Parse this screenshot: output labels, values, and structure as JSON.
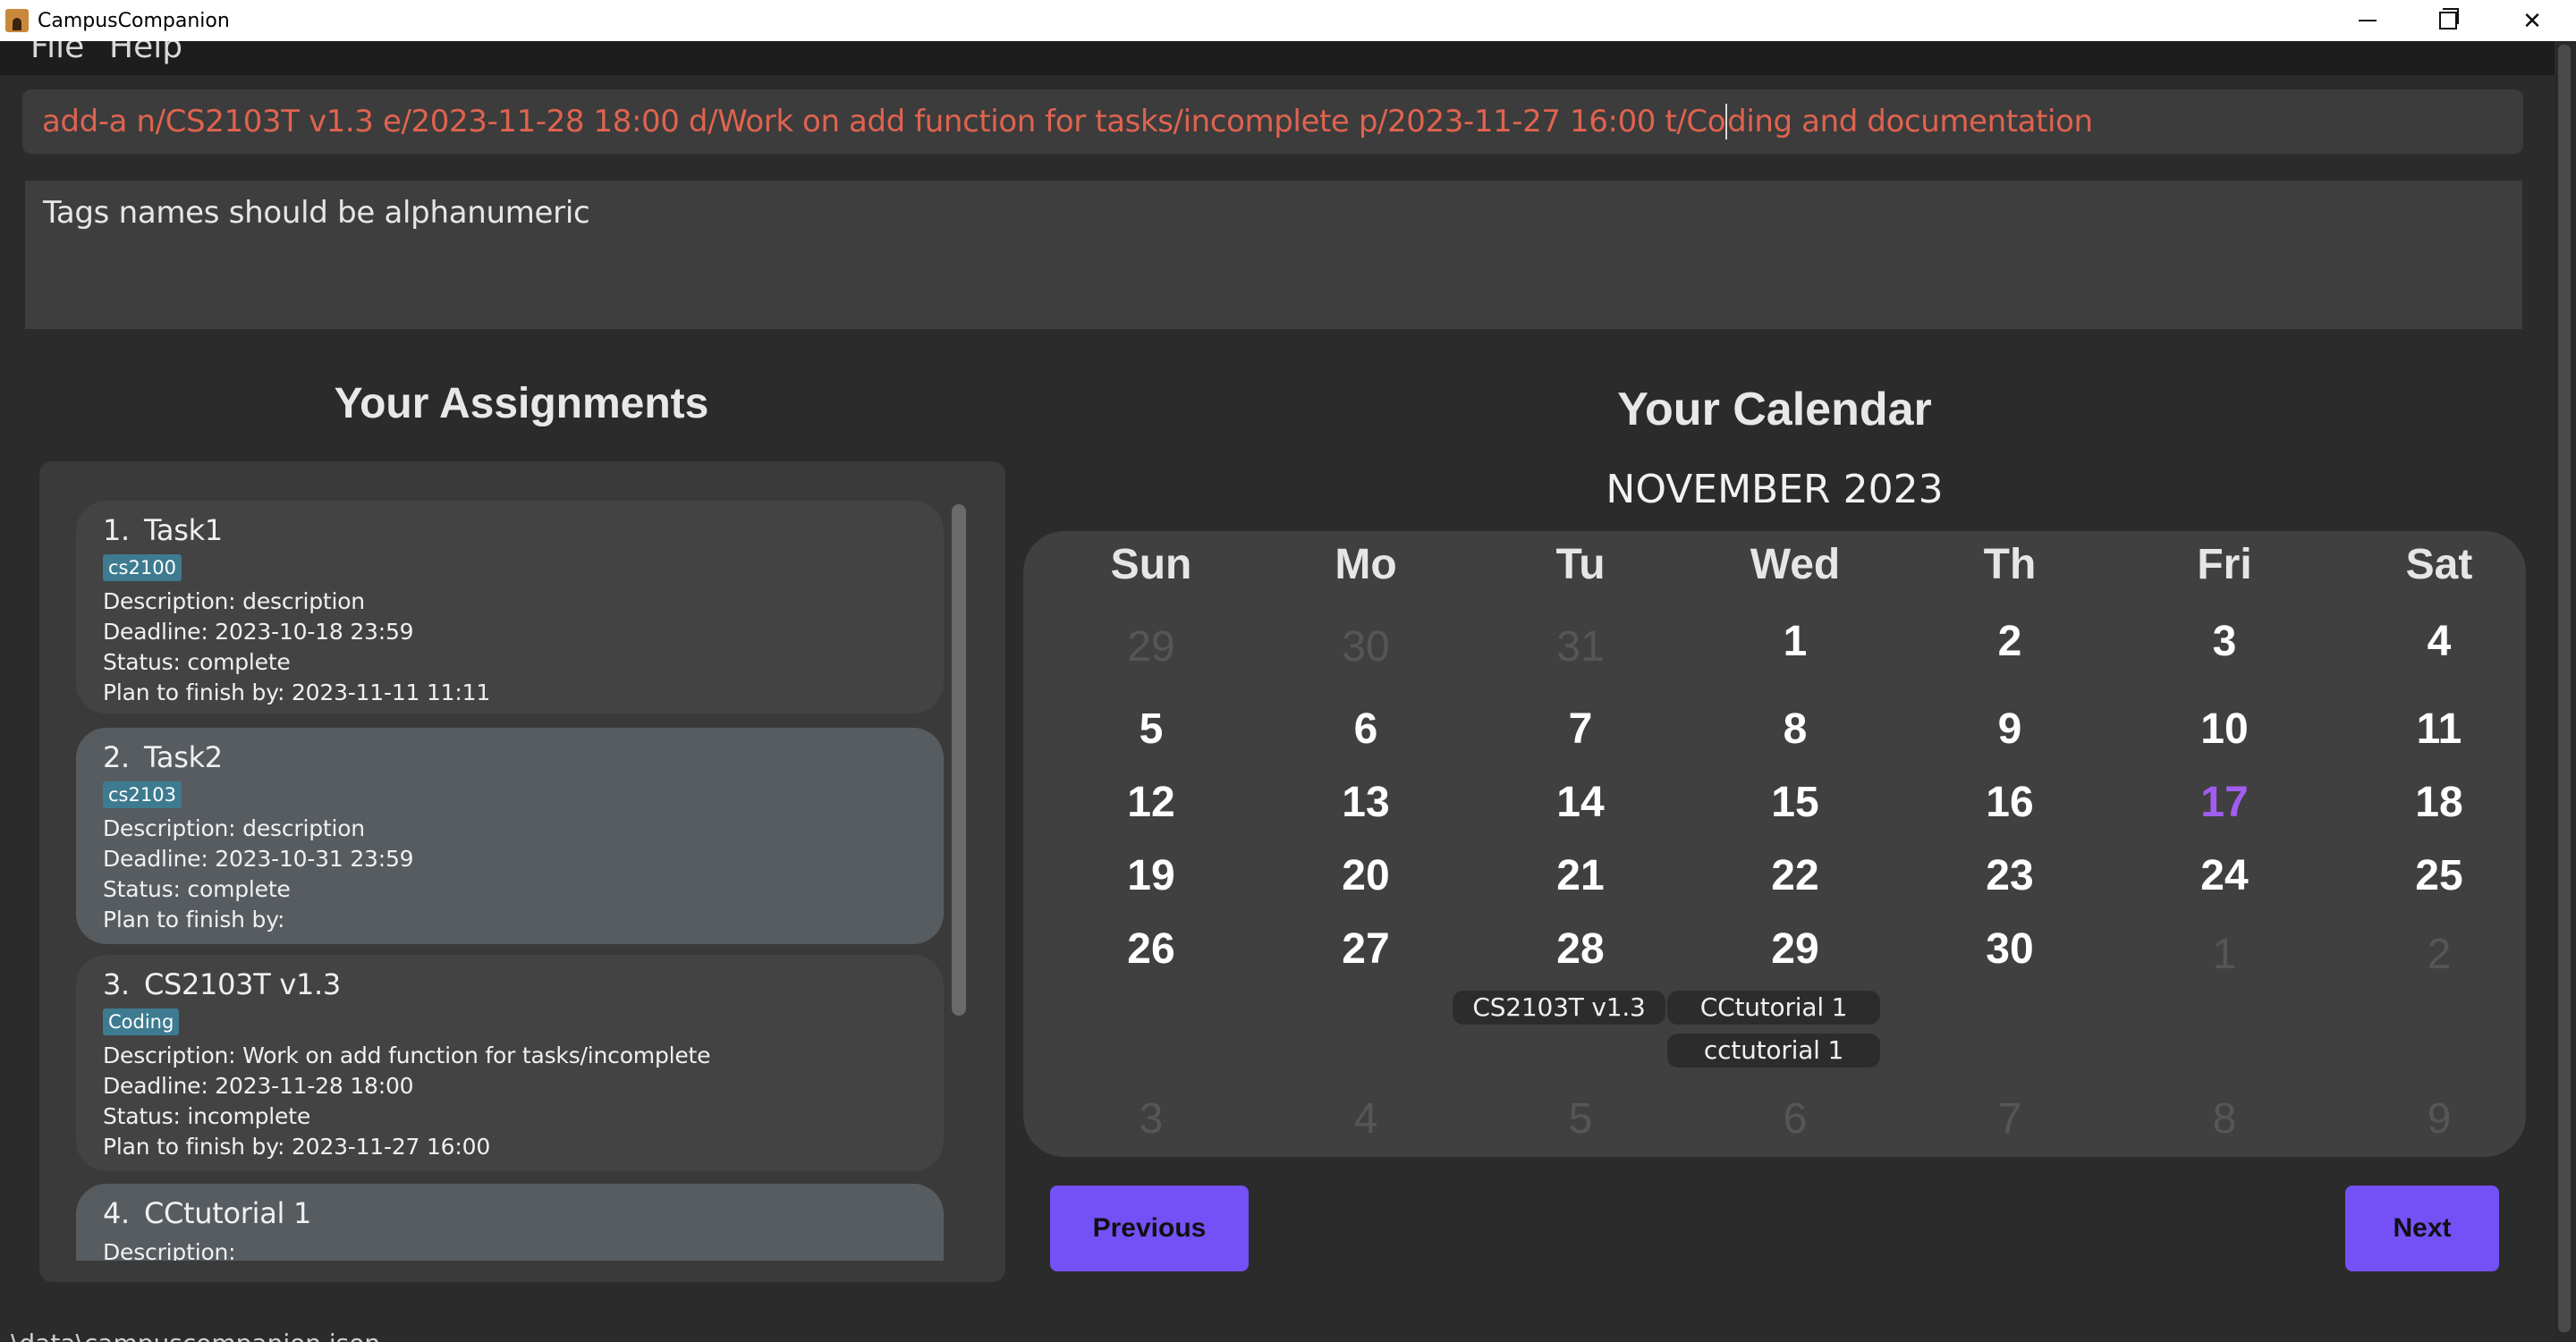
{
  "window": {
    "title": "CampusCompanion",
    "minimize_glyph": "",
    "maximize_glyph": "",
    "close_glyph": "✕"
  },
  "menu": {
    "file": "File",
    "help": "Help"
  },
  "command": {
    "text_before_caret": "add-a n/CS2103T v1.3 e/2023-11-28 18:00 d/Work on add function for tasks/incomplete p/2023-11-27 16:00 t/Co",
    "text_after_caret": "ding and documentation"
  },
  "result": {
    "message": "Tags names should be alphanumeric"
  },
  "assignments": {
    "title": "Your Assignments",
    "items": [
      {
        "index": "1.",
        "name": "Task1",
        "tag": "cs2100",
        "description": "Description: description",
        "deadline": "Deadline: 2023-10-18 23:59",
        "status": "Status: complete",
        "plan": "Plan to finish by: 2023-11-11 11:11"
      },
      {
        "index": "2.",
        "name": "Task2",
        "tag": "cs2103",
        "description": "Description: description",
        "deadline": "Deadline: 2023-10-31 23:59",
        "status": "Status: complete",
        "plan": "Plan to finish by:"
      },
      {
        "index": "3.",
        "name": "CS2103T v1.3",
        "tag": "Coding",
        "description": "Description: Work on add function for tasks/incomplete",
        "deadline": "Deadline: 2023-11-28 18:00",
        "status": "Status: incomplete",
        "plan": "Plan to finish by: 2023-11-27 16:00"
      },
      {
        "index": "4.",
        "name": "CCtutorial 1",
        "description": "Description:"
      }
    ]
  },
  "calendar": {
    "title": "Your Calendar",
    "month": "NOVEMBER 2023",
    "weekdays": [
      "Sun",
      "Mo",
      "Tu",
      "Wed",
      "Th",
      "Fri",
      "Sat"
    ],
    "weeks": [
      [
        "29",
        "30",
        "31",
        "1",
        "2",
        "3",
        "4"
      ],
      [
        "5",
        "6",
        "7",
        "8",
        "9",
        "10",
        "11"
      ],
      [
        "12",
        "13",
        "14",
        "15",
        "16",
        "17",
        "18"
      ],
      [
        "19",
        "20",
        "21",
        "22",
        "23",
        "24",
        "25"
      ],
      [
        "26",
        "27",
        "28",
        "29",
        "30",
        "1",
        "2"
      ],
      [
        "3",
        "4",
        "5",
        "6",
        "7",
        "8",
        "9"
      ]
    ],
    "today": "17",
    "events": {
      "tu_28": "CS2103T v1.3",
      "wed_29_a": "CCtutorial 1",
      "wed_29_b": "cctutorial 1"
    },
    "previous_label": "Previous",
    "next_label": "Next"
  },
  "status_bar": {
    "text": "\\data\\campuscompanion.json"
  },
  "colors": {
    "accent": "#7351f7",
    "today": "#a25cf0",
    "tag": "#3e7b91",
    "error_text": "#e0634f"
  }
}
